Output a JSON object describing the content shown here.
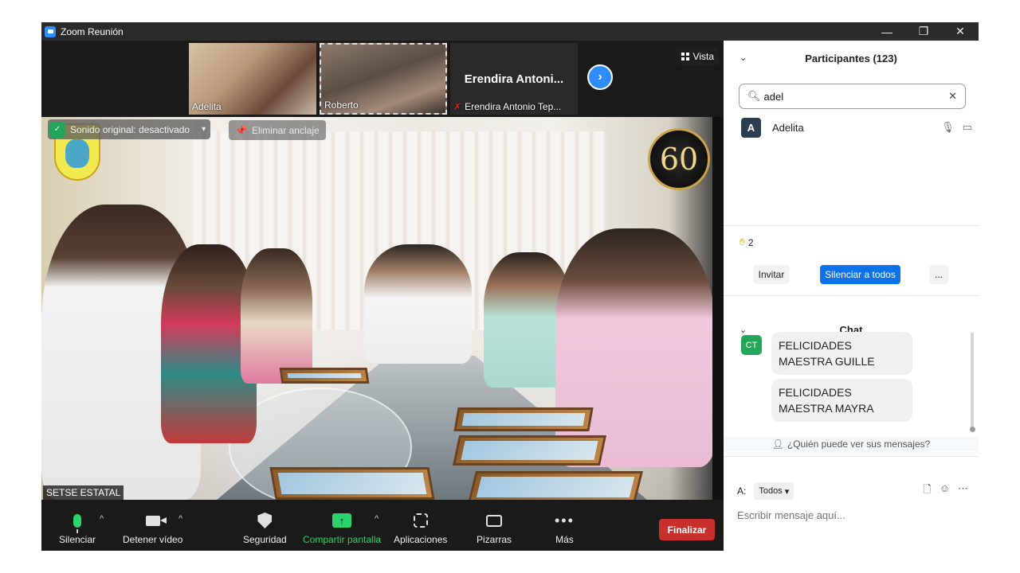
{
  "window": {
    "title": "Zoom Reunión",
    "controls": {
      "minimize": "—",
      "restore": "❐",
      "close": "✕"
    }
  },
  "thumbnails": [
    {
      "name": "Adelita"
    },
    {
      "name": "Roberto"
    },
    {
      "name": "Erendira Antonio Tep...",
      "display_name": "Erendira  Antoni..."
    }
  ],
  "view_button": {
    "label": "Vista",
    "icon": "grid-icon"
  },
  "next_page_icon": "chevron-right-icon",
  "stage": {
    "audio_status": "Sonido original: desactivado",
    "unpin_label": "Eliminar anclaje",
    "speaker_label": "SETSE ESTATAL",
    "badge_text": "60"
  },
  "toolbar": {
    "mute": "Silenciar",
    "video": "Detener vídeo",
    "security": "Seguridad",
    "share": "Compartir pantalla",
    "apps": "Aplicaciones",
    "whiteboards": "Pizarras",
    "more": "Más",
    "end": "Finalizar"
  },
  "participants": {
    "header": "Participantes (123)",
    "search_value": "adel",
    "list": [
      {
        "initial": "A",
        "name": "Adelita"
      }
    ],
    "raised_hands": "2",
    "invite": "Invitar",
    "mute_all": "Silenciar a todos",
    "more": "..."
  },
  "chat": {
    "header": "Chat",
    "sender_initials": "CT",
    "messages": [
      "FELICIDADES MAESTRA GUILLE",
      "FELICIDADES MAESTRA MAYRA"
    ],
    "who_can_see": "¿Quién puede ver sus mensajes?",
    "to_label": "A:",
    "to_value": "Todos",
    "input_placeholder": "Escribir mensaje aquí..."
  },
  "colors": {
    "accent": "#0e72ed",
    "end_button": "#c8302c",
    "active_green": "#2bd36b",
    "toolbar_bg": "#1a1a1a"
  }
}
